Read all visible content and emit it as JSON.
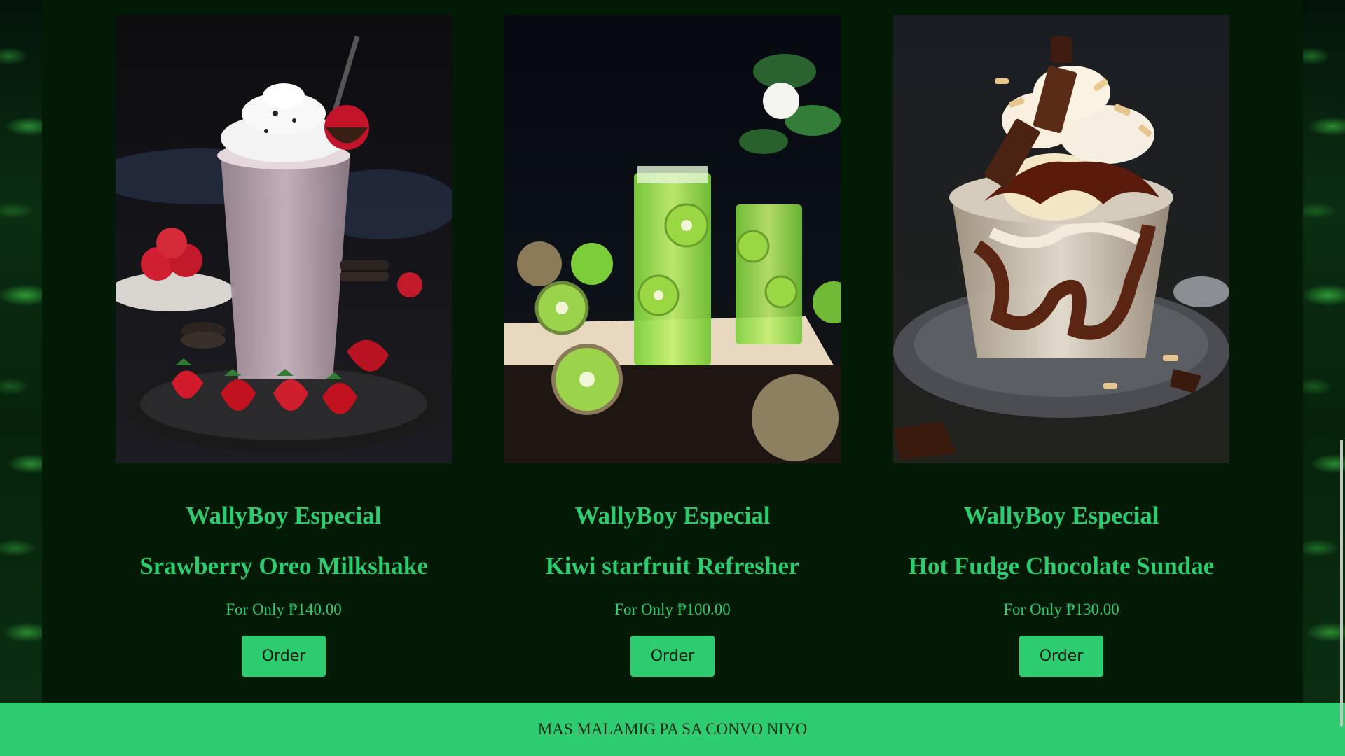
{
  "products": [
    {
      "brand": "WallyBoy Especial",
      "name": "Srawberry Oreo Milkshake",
      "price": "For Only ₱140.00",
      "order_label": "Order"
    },
    {
      "brand": "WallyBoy Especial",
      "name": "Kiwi starfruit Refresher",
      "price": "For Only ₱100.00",
      "order_label": "Order"
    },
    {
      "brand": "WallyBoy Especial",
      "name": "Hot Fudge Chocolate Sundae",
      "price": "For Only ₱130.00",
      "order_label": "Order"
    }
  ],
  "footer": {
    "text": "MAS MALAMIG PA SA CONVO NIYO"
  },
  "colors": {
    "background": "#021a06",
    "accent": "#2ecc71",
    "footer_text": "#0f2a14"
  },
  "icons": [
    "milkshake-photo",
    "kiwi-refresher-photo",
    "fudge-sundae-photo"
  ]
}
